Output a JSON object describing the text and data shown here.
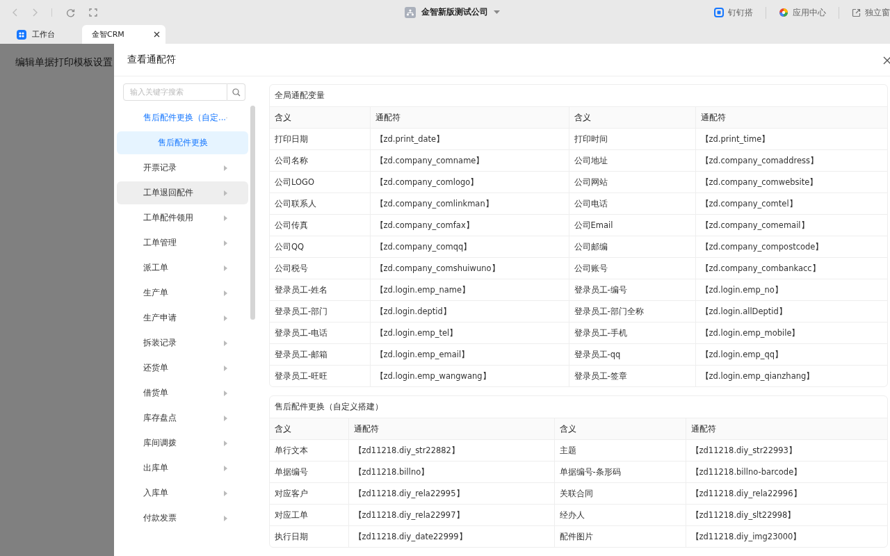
{
  "browser": {
    "company": "金智新版测试公司",
    "links": [
      {
        "label": "钉钉搭",
        "kind": "dingtalk"
      },
      {
        "label": "应用中心",
        "kind": "apps"
      },
      {
        "label": "独立窗",
        "kind": "window"
      }
    ]
  },
  "tabs": [
    {
      "label": "工作台",
      "selected": false,
      "closable": false
    },
    {
      "label": "金智CRM",
      "selected": true,
      "closable": true
    }
  ],
  "page_title": "编辑单据打印模板设置",
  "drawer": {
    "title": "查看通配符",
    "search": {
      "placeholder": "输入关键字搜索"
    },
    "menu": [
      {
        "label": "售后配件更换（自定...",
        "expanded": true,
        "hovered": false,
        "children": [
          {
            "label": "售后配件更换",
            "selected": true
          }
        ]
      },
      {
        "label": "开票记录",
        "expanded": false,
        "hovered": false
      },
      {
        "label": "工单退回配件",
        "expanded": false,
        "hovered": true
      },
      {
        "label": "工单配件领用",
        "expanded": false,
        "hovered": false
      },
      {
        "label": "工单管理",
        "expanded": false,
        "hovered": false
      },
      {
        "label": "派工单",
        "expanded": false,
        "hovered": false
      },
      {
        "label": "生产单",
        "expanded": false,
        "hovered": false
      },
      {
        "label": "生产申请",
        "expanded": false,
        "hovered": false
      },
      {
        "label": "拆装记录",
        "expanded": false,
        "hovered": false
      },
      {
        "label": "还货单",
        "expanded": false,
        "hovered": false
      },
      {
        "label": "借货单",
        "expanded": false,
        "hovered": false
      },
      {
        "label": "库存盘点",
        "expanded": false,
        "hovered": false
      },
      {
        "label": "库间调拨",
        "expanded": false,
        "hovered": false
      },
      {
        "label": "出库单",
        "expanded": false,
        "hovered": false
      },
      {
        "label": "入库单",
        "expanded": false,
        "hovered": false
      },
      {
        "label": "付款发票",
        "expanded": false,
        "hovered": false
      }
    ],
    "sections": [
      {
        "title": "全局通配变量",
        "columns": [
          "含义",
          "通配符",
          "含义",
          "通配符"
        ],
        "rows": [
          [
            "打印日期",
            "【zd.print_date】",
            "打印时间",
            "【zd.print_time】"
          ],
          [
            "公司名称",
            "【zd.company_comname】",
            "公司地址",
            "【zd.company_comaddress】"
          ],
          [
            "公司LOGO",
            "【zd.company_comlogo】",
            "公司网站",
            "【zd.company_comwebsite】"
          ],
          [
            "公司联系人",
            "【zd.company_comlinkman】",
            "公司电话",
            "【zd.company_comtel】"
          ],
          [
            "公司传真",
            "【zd.company_comfax】",
            "公司Email",
            "【zd.company_comemail】"
          ],
          [
            "公司QQ",
            "【zd.company_comqq】",
            "公司邮编",
            "【zd.company_compostcode】"
          ],
          [
            "公司税号",
            "【zd.company_comshuiwuno】",
            "公司账号",
            "【zd.company_combankacc】"
          ],
          [
            "登录员工-姓名",
            "【zd.login.emp_name】",
            "登录员工-编号",
            "【zd.login.emp_no】"
          ],
          [
            "登录员工-部门",
            "【zd.login.deptid】",
            "登录员工-部门全称",
            "【zd.login.allDeptid】"
          ],
          [
            "登录员工-电话",
            "【zd.login.emp_tel】",
            "登录员工-手机",
            "【zd.login.emp_mobile】"
          ],
          [
            "登录员工-邮箱",
            "【zd.login.emp_email】",
            "登录员工-qq",
            "【zd.login.emp_qq】"
          ],
          [
            "登录员工-旺旺",
            "【zd.login.emp_wangwang】",
            "登录员工-签章",
            "【zd.login.emp_qianzhang】"
          ]
        ]
      },
      {
        "title": "售后配件更换（自定义搭建）",
        "columns": [
          "含义",
          "通配符",
          "含义",
          "通配符"
        ],
        "rows": [
          [
            "单行文本",
            "【zd11218.diy_str22882】",
            "主题",
            "【zd11218.diy_str22993】"
          ],
          [
            "单据编号",
            "【zd11218.billno】",
            "单据编号-条形码",
            "【zd11218.billno-barcode】"
          ],
          [
            "对应客户",
            "【zd11218.diy_rela22995】",
            "关联合同",
            "【zd11218.diy_rela22996】"
          ],
          [
            "对应工单",
            "【zd11218.diy_rela22997】",
            "经办人",
            "【zd11218.diy_slt22998】"
          ],
          [
            "执行日期",
            "【zd11218.diy_date22999】",
            "配件图片",
            "【zd11218.diy_img23000】"
          ]
        ]
      }
    ]
  }
}
